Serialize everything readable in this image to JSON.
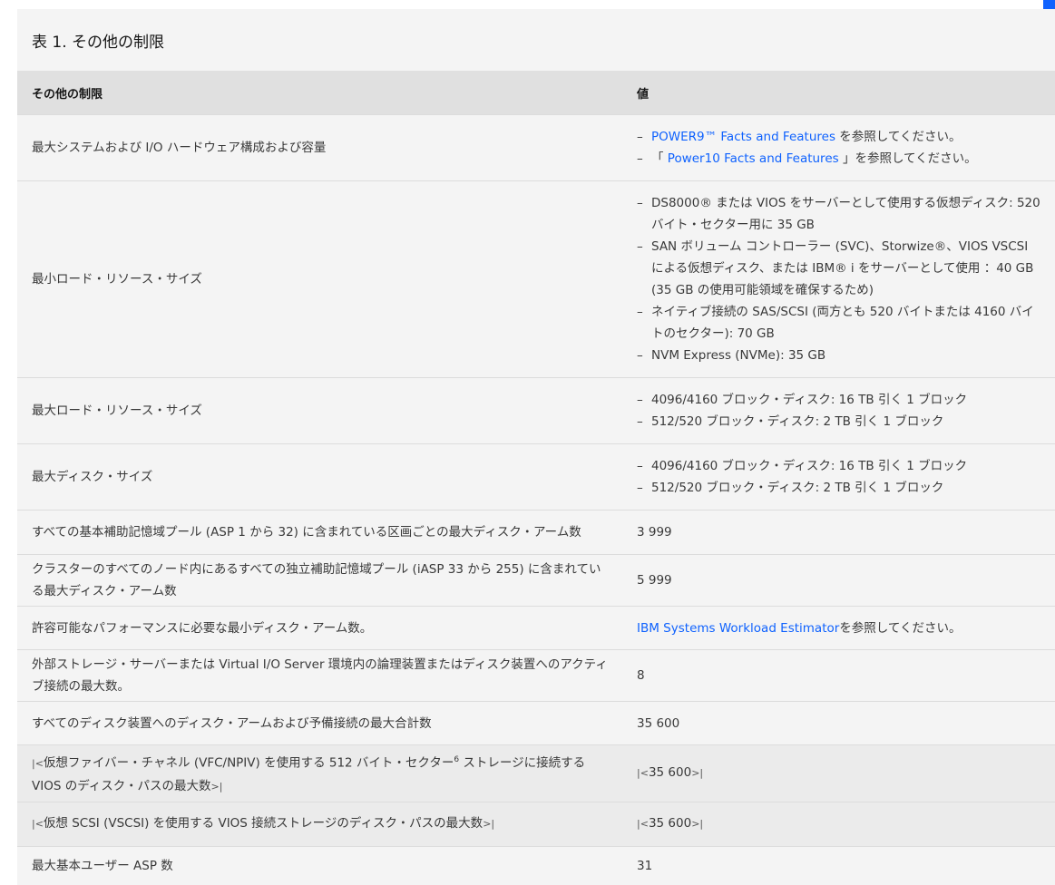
{
  "caption": "表 1. その他の制限",
  "headers": [
    "その他の制限",
    "値"
  ],
  "rows": [
    {
      "label": "最大システムおよび I/O ハードウェア構成および容量",
      "items": [
        {
          "link": "POWER9™ Facts and Features",
          "pre": "",
          "post": " を参照してください。"
        },
        {
          "link": " Power10 Facts and Features ",
          "pre": "「",
          "post": "」を参照してください。"
        }
      ]
    },
    {
      "label": "最小ロード・リソース・サイズ",
      "items": [
        {
          "text": "DS8000® または VIOS をサーバーとして使用する仮想ディスク: 520 バイト・セクター用に 35 GB"
        },
        {
          "text": "SAN ボリューム コントローラー (SVC)、Storwize®、VIOS VSCSI による仮想ディスク、または IBM® i をサーバーとして使用 ：40 GB (35 GB の使用可能領域を確保するため)"
        },
        {
          "text": "ネイティブ接続の SAS/SCSI (両方とも 520 バイトまたは 4160 バイトのセクター): 70 GB"
        },
        {
          "text": "NVM Express (NVMe): 35 GB"
        }
      ]
    },
    {
      "label": "最大ロード・リソース・サイズ",
      "items": [
        {
          "text": "4096/4160 ブロック・ディスク: 16 TB 引く 1 ブロック"
        },
        {
          "text": "512/520 ブロック・ディスク: 2 TB 引く 1 ブロック"
        }
      ]
    },
    {
      "label": "最大ディスク・サイズ",
      "items": [
        {
          "text": "4096/4160 ブロック・ディスク: 16 TB 引く 1 ブロック"
        },
        {
          "text": "512/520 ブロック・ディスク: 2 TB 引く 1 ブロック"
        }
      ]
    },
    {
      "label": "すべての基本補助記憶域プール (ASP 1 から 32) に含まれている区画ごとの最大ディスク・アーム数",
      "value": "3 999"
    },
    {
      "label": "クラスターのすべてのノード内にあるすべての独立補助記憶域プール (iASP 33 から 255) に含まれている最大ディスク・アーム数",
      "value": "5 999"
    },
    {
      "label": "許容可能なパフォーマンスに必要な最小ディスク・アーム数。",
      "link": "IBM Systems Workload Estimator",
      "post": "を参照してください。"
    },
    {
      "label": "外部ストレージ・サーバーまたは Virtual I/O Server 環境内の論理装置またはディスク装置へのアクティブ接続の最大数。",
      "value": "8"
    },
    {
      "label": "すべてのディスク装置へのディスク・アームおよび予備接続の最大合計数",
      "value": "35 600"
    },
    {
      "label_a": "仮想ファイバー・チャネル (VFC/NPIV) を使用する 512 バイト・セクター",
      "sup": "6",
      "label_b": " ストレージに接続する VIOS のディスク・パスの最大数",
      "value": "35 600",
      "changed": true
    },
    {
      "label": "仮想 SCSI (VSCSI) を使用する VIOS 接続ストレージのディスク・パスの最大数",
      "value": "35 600",
      "changed": true
    },
    {
      "label": "最大基本ユーザー ASP 数",
      "value": "31"
    }
  ],
  "change_start": "|<",
  "change_end": ">|"
}
